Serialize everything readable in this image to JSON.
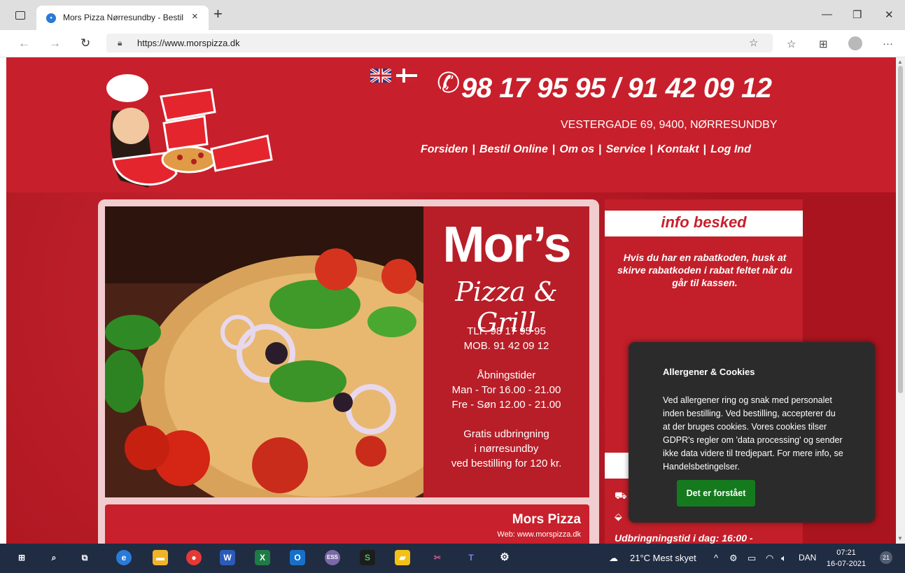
{
  "browser": {
    "tab_title": "Mors Pizza Nørresundby - Bestil",
    "tab_close": "×",
    "new_tab": "+",
    "url": "https://www.morspizza.dk",
    "window_controls": {
      "minimize": "—",
      "restore": "❐",
      "close": "✕"
    }
  },
  "header": {
    "phone": "98 17 95 95 / 91 42 09 12",
    "address": "VESTERGADE 69, 9400, NØRRESUNDBY",
    "nav": [
      "Forsiden",
      "Bestil Online",
      "Om os",
      "Service",
      "Kontakt",
      "Log Ind"
    ],
    "nav_separator": "|"
  },
  "banner": {
    "title": "Mor’s",
    "subtitle": "Pizza & Grill",
    "tlf": "TLF. 98 17 95 95",
    "mob": "MOB. 91 42 09 12",
    "hours_title": "Åbningstider",
    "hours_1": "Man - Tor 16.00 - 21.00",
    "hours_2": "Fre - Søn 12.00 - 21.00",
    "delivery_1": "Gratis udbringning",
    "delivery_2": "i nørresundby",
    "delivery_3": "ved bestilling for 120 kr."
  },
  "card": {
    "name": "Mors Pizza",
    "web": "Web: www.morspizza.dk"
  },
  "info": {
    "title": "info besked",
    "message": "Hvis du har en rabatkoden, husk at skirve rabatkoden i rabat feltet når du går til kassen.",
    "delivery_time": "Udbringningstid i dag: 16:00 -"
  },
  "cookie": {
    "title": "Allergener & Cookies",
    "text": "Ved allergener ring og snak med personalet inden bestilling. Ved bestilling, accepterer du at der bruges cookies. Vores cookies tilser GDPR's regler om 'data processing' og sender ikke data videre til tredjepart. For mere info, se Handelsbetingelser.",
    "button": "Det er forstået"
  },
  "taskbar": {
    "weather": "21°C  Mest skyet",
    "language": "DAN",
    "time": "07:21",
    "date": "16-07-2021",
    "notifications": "21"
  }
}
